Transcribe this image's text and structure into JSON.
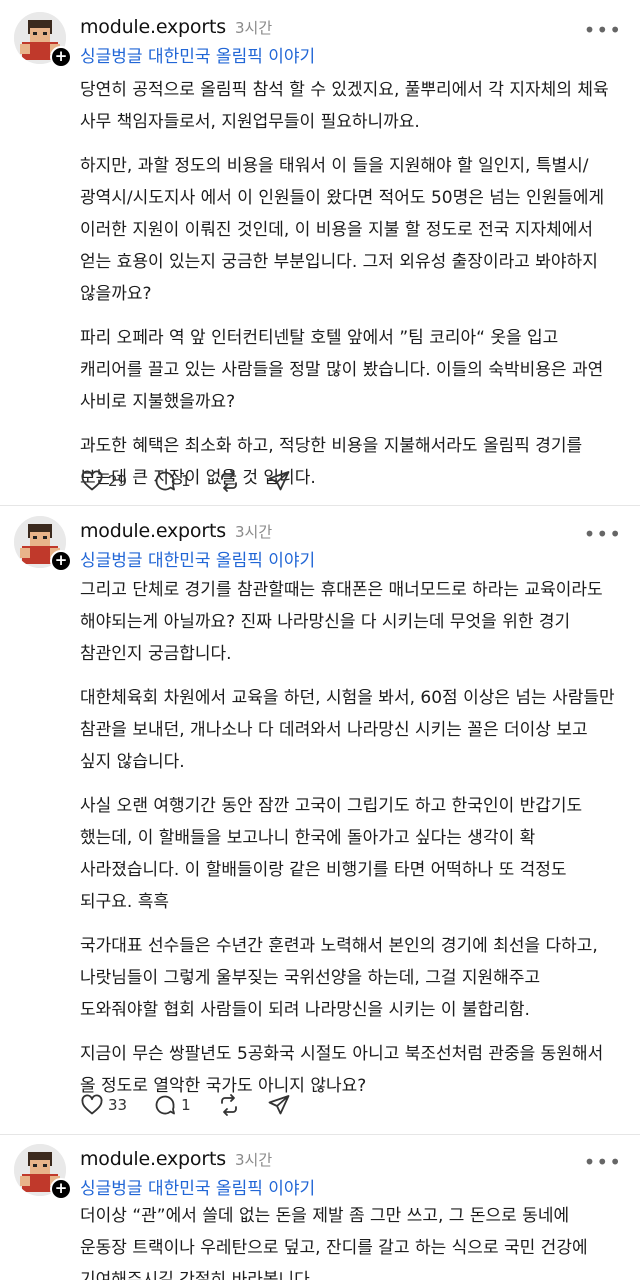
{
  "posts": [
    {
      "username": "module.exports",
      "time": "3시간",
      "community": "싱글벙글 대한민국 올림픽 이야기",
      "paragraphs": [
        "당연히 공적으로 올림픽 참석 할 수 있겠지요, 풀뿌리에서 각 지자체의 체육 사무 책임자들로서, 지원업무들이 필요하니까요.",
        "하지만, 과할 정도의 비용을 태워서 이 들을 지원해야 할 일인지, 특별시/ 광역시/시도지사 에서 이 인원들이 왔다면 적어도 50명은 넘는 인원들에게 이러한 지원이 이뤄진 것인데, 이 비용을 지불 할 정도로 전국 지자체에서 얻는 효용이 있는지 궁금한 부분입니다. 그저 외유성 출장이라고 봐야하지 않을까요?",
        "파리 오페라 역 앞 인터컨티넨탈 호텔 앞에서 ”팀 코리아“ 옷을 입고 캐리어를 끌고 있는 사람들을 정말 많이 봤습니다. 이들의 숙박비용은 과연 사비로 지불했을까요?",
        "과도한 혜택은 최소화 하고, 적당한 비용을 지불해서라도 올림픽 경기를 보는데 큰 지장이 없을 것 입니다."
      ],
      "likes": "29",
      "replies": "1"
    },
    {
      "username": "module.exports",
      "time": "3시간",
      "community": "싱글벙글 대한민국 올림픽 이야기",
      "paragraphs": [
        "그리고 단체로 경기를 참관할때는 휴대폰은 매너모드로 하라는 교육이라도 해야되는게 아닐까요? 진짜 나라망신을 다 시키는데 무엇을 위한 경기 참관인지 궁금합니다.",
        "대한체육회 차원에서 교육을 하던, 시험을 봐서, 60점 이상은 넘는 사람들만 참관을 보내던, 개나소나 다 데려와서 나라망신 시키는 꼴은 더이상 보고 싶지 않습니다.",
        "사실 오랜 여행기간 동안 잠깐 고국이 그립기도 하고 한국인이 반갑기도 했는데, 이 할배들을 보고나니 한국에 돌아가고 싶다는 생각이 확 사라졌습니다. 이 할배들이랑 같은 비행기를 타면 어떡하나 또 걱정도 되구요. 흑흑",
        "국가대표 선수들은 수년간 훈련과 노력해서 본인의 경기에 최선을 다하고, 나랏님들이 그렇게 울부짖는 국위선양을 하는데, 그걸 지원해주고 도와줘야할 협회 사람들이 되려 나라망신을 시키는 이 불합리함.",
        "지금이 무슨 쌍팔년도 5공화국 시절도 아니고 북조선처럼 관중을 동원해서 올 정도로 열악한 국가도 아니지 않나요?"
      ],
      "likes": "33",
      "replies": "1"
    },
    {
      "username": "module.exports",
      "time": "3시간",
      "community": "싱글벙글 대한민국 올림픽 이야기",
      "paragraphs": [
        "더이상 “관”에서 쓸데 없는 돈을 제발 좀 그만 쓰고, 그 돈으로 동네에 운동장 트랙이나 우레탄으로 덮고, 잔디를 갈고 하는 식으로 국민 건강에 기여해주시길 간절히 바라봅니다."
      ]
    }
  ],
  "icons": {
    "more": "more-icon",
    "like": "heart-icon",
    "reply": "comment-icon",
    "repost": "repost-icon",
    "share": "share-icon",
    "follow": "plus-icon"
  },
  "colors": {
    "community_link": "#2166d6",
    "time": "#8a8a8a"
  }
}
